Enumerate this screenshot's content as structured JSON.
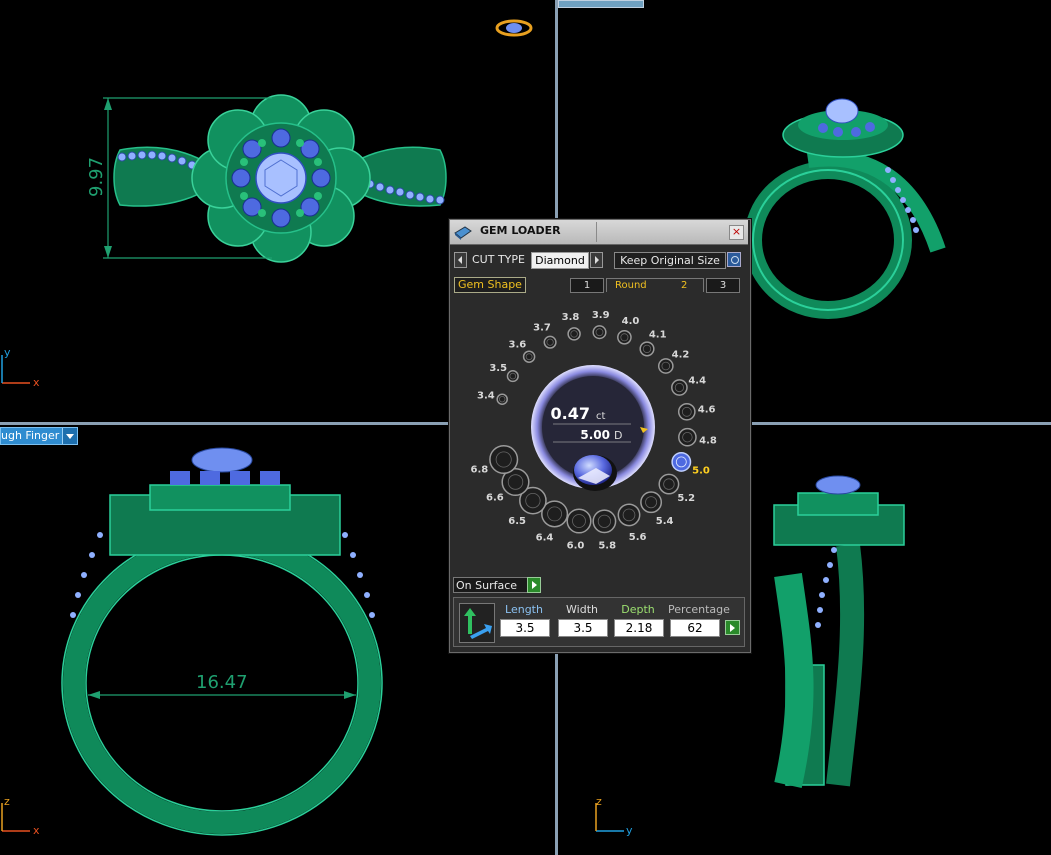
{
  "viewports": {
    "top_left": {
      "dimension": "9.97",
      "axis_x": "x",
      "axis_y": "y"
    },
    "top_right": {},
    "bottom_left": {
      "view_mode": "ugh Finger",
      "dimension": "16.47",
      "axis_x": "x",
      "axis_z": "z"
    },
    "bottom_right": {
      "axis_y": "y",
      "axis_z": "z"
    }
  },
  "gem_loader": {
    "title": "GEM LOADER",
    "close": "×",
    "cut_type_label": "CUT TYPE",
    "cut_type_value": "Diamond",
    "keep_original_size": "Keep Original Size",
    "tab_gem_shape": "Gem Shape",
    "tabs": [
      {
        "label": "1"
      },
      {
        "label": "Round",
        "number": "2",
        "active": true
      },
      {
        "label": "3"
      }
    ],
    "carat": "0.47",
    "carat_unit": "ct",
    "diameter": "5.00",
    "diameter_unit": "D",
    "sizes": [
      "3.4",
      "3.5",
      "3.6",
      "3.7",
      "3.8",
      "3.9",
      "4.0",
      "4.1",
      "4.2",
      "4.4",
      "4.6",
      "4.8",
      "5.0",
      "5.2",
      "5.4",
      "5.6",
      "5.8",
      "6.0",
      "6.4",
      "6.5",
      "6.6",
      "6.8"
    ],
    "selected_size": "5.0",
    "on_surface": "On Surface",
    "length_label": "Length",
    "width_label": "Width",
    "depth_label": "Depth",
    "percentage_label": "Percentage",
    "length_value": "3.5",
    "width_value": "3.5",
    "depth_value": "2.18",
    "percentage_value": "62"
  },
  "colors": {
    "ring_green": "#0f8a5a",
    "gem_blue": "#6f8ff0",
    "accent_yellow": "#f0c020",
    "selected_size": "#ffd020"
  }
}
